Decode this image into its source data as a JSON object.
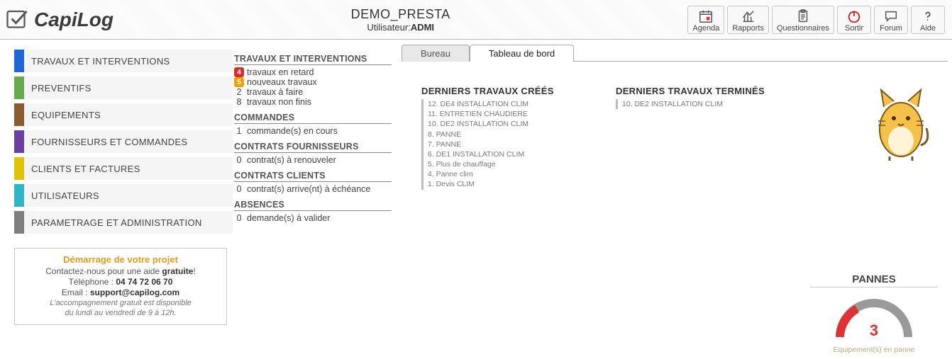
{
  "header": {
    "logo_text": "CapiLog",
    "title": "DEMO_PRESTA",
    "user_label": "Utilisateur:",
    "user_value": "ADMI"
  },
  "toolbar": [
    {
      "key": "agenda",
      "label": "Agenda",
      "icon": "calendar-icon"
    },
    {
      "key": "rapports",
      "label": "Rapports",
      "icon": "chart-icon"
    },
    {
      "key": "questionnaires",
      "label": "Questionnaires",
      "icon": "clipboard-icon"
    },
    {
      "key": "sortir",
      "label": "Sortir",
      "icon": "power-icon"
    },
    {
      "key": "forum",
      "label": "Forum",
      "icon": "speech-icon"
    },
    {
      "key": "aide",
      "label": "Aide",
      "icon": "help-icon"
    }
  ],
  "nav": [
    {
      "color": "cb-blue",
      "label": "TRAVAUX ET INTERVENTIONS"
    },
    {
      "color": "cb-green",
      "label": "PREVENTIFS"
    },
    {
      "color": "cb-brown",
      "label": "EQUIPEMENTS"
    },
    {
      "color": "cb-purple",
      "label": "FOURNISSEURS ET COMMANDES"
    },
    {
      "color": "cb-yellow",
      "label": "CLIENTS ET FACTURES"
    },
    {
      "color": "cb-cyan",
      "label": "UTILISATEURS"
    },
    {
      "color": "cb-grey",
      "label": "PARAMETRAGE ET ADMINISTRATION"
    }
  ],
  "support": {
    "title": "Démarrage de votre projet",
    "line1a": "Contactez-nous pour une aide ",
    "line1b": "gratuite",
    "tel_label": "Téléphone : ",
    "tel": "04 74 72 06 70",
    "email_label": "Email : ",
    "email": "support@capilog.com",
    "small1": "L'accompagnement gratuit est disponible",
    "small2": "du lundi au vendredi de 9 à 12h."
  },
  "stats": {
    "travaux_title": "TRAVAUX ET INTERVENTIONS",
    "travaux_rows": [
      {
        "badge": "red",
        "n": "4",
        "text": "travaux en retard"
      },
      {
        "badge": "orange",
        "n": "5",
        "text": "nouveaux travaux"
      },
      {
        "badge": "",
        "n": "2",
        "text": "travaux à faire"
      },
      {
        "badge": "",
        "n": "8",
        "text": "travaux non finis"
      }
    ],
    "commandes_title": "COMMANDES",
    "commandes_row": {
      "n": "1",
      "text": "commande(s) en cours"
    },
    "cf_title": "CONTRATS FOURNISSEURS",
    "cf_row": {
      "n": "0",
      "text": "contrat(s) à renouveler"
    },
    "cc_title": "CONTRATS CLIENTS",
    "cc_row": {
      "n": "0",
      "text": "contrat(s) arrive(nt) à échéance"
    },
    "abs_title": "ABSENCES",
    "abs_row": {
      "n": "0",
      "text": "demande(s) à valider"
    }
  },
  "tabs": {
    "bureau": "Bureau",
    "tableau": "Tableau de bord"
  },
  "panel1": {
    "title": "DERNIERS TRAVAUX CRÉÉS",
    "items": [
      "12. DE4 INSTALLATION CLIM",
      "11. ENTRETIEN CHAUDIERE",
      "10. DE2 INSTALLATION CLIM",
      "8. PANNE",
      "7. PANNE",
      "6. DE1 INSTALLATION CLIM",
      "5. Plus de chauffage",
      "4. Panne clim",
      "1. Devis CLIM"
    ]
  },
  "panel2": {
    "title": "DERNIERS TRAVAUX TERMINÉS",
    "items": [
      "10. DE2 INSTALLATION CLIM"
    ]
  },
  "pannes": {
    "title": "PANNES",
    "value": "3",
    "sub": "Equipement(s) en panne"
  }
}
